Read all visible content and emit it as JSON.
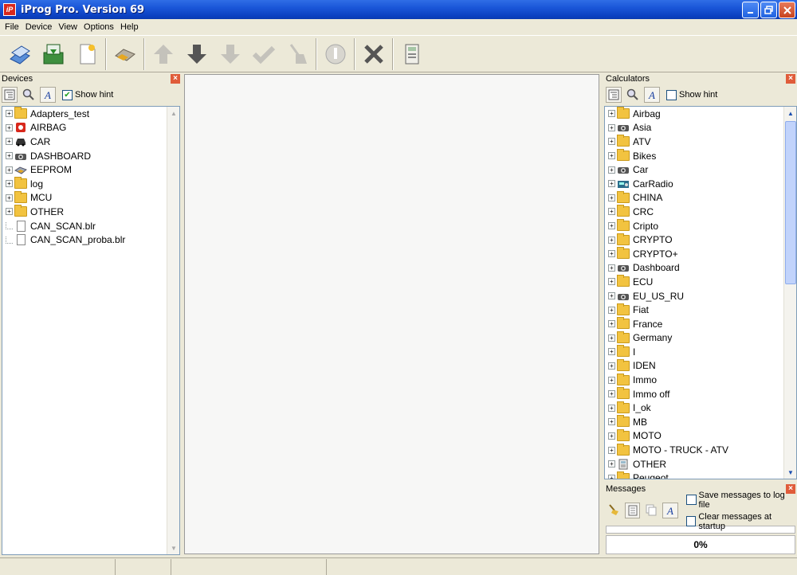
{
  "window": {
    "title": "iProg Pro. Version 69",
    "icon_text": "iP"
  },
  "menu": [
    "File",
    "Device",
    "View",
    "Options",
    "Help"
  ],
  "devices": {
    "title": "Devices",
    "show_hint_label": "Show hint",
    "show_hint_checked": true,
    "items": [
      {
        "label": "Adapters_test",
        "icon": "folder-icon",
        "expandable": true
      },
      {
        "label": "AIRBAG",
        "icon": "airbag-icon",
        "expandable": true
      },
      {
        "label": "CAR",
        "icon": "car-icon",
        "expandable": true
      },
      {
        "label": "DASHBOARD",
        "icon": "dashboard-icon",
        "expandable": true
      },
      {
        "label": "EEPROM",
        "icon": "eeprom-icon",
        "expandable": true
      },
      {
        "label": "log",
        "icon": "folder-icon",
        "expandable": true
      },
      {
        "label": "MCU",
        "icon": "folder-icon",
        "expandable": true
      },
      {
        "label": "OTHER",
        "icon": "folder-icon",
        "expandable": true
      },
      {
        "label": "CAN_SCAN.blr",
        "icon": "file-icon",
        "expandable": false
      },
      {
        "label": "CAN_SCAN_proba.blr",
        "icon": "file-icon",
        "expandable": false
      }
    ]
  },
  "calculators": {
    "title": "Calculators",
    "show_hint_label": "Show hint",
    "show_hint_checked": false,
    "items": [
      {
        "label": "Airbag",
        "icon": "folder-icon"
      },
      {
        "label": "Asia",
        "icon": "camera-icon"
      },
      {
        "label": "ATV",
        "icon": "folder-icon"
      },
      {
        "label": "Bikes",
        "icon": "folder-icon"
      },
      {
        "label": "Car",
        "icon": "camera-icon"
      },
      {
        "label": "CarRadio",
        "icon": "radio-icon"
      },
      {
        "label": "CHINA",
        "icon": "folder-icon"
      },
      {
        "label": "CRC",
        "icon": "folder-icon"
      },
      {
        "label": "Cripto",
        "icon": "folder-icon"
      },
      {
        "label": "CRYPTO",
        "icon": "folder-icon"
      },
      {
        "label": "CRYPTO+",
        "icon": "folder-icon"
      },
      {
        "label": "Dashboard",
        "icon": "camera-icon"
      },
      {
        "label": "ECU",
        "icon": "folder-icon"
      },
      {
        "label": "EU_US_RU",
        "icon": "camera-icon"
      },
      {
        "label": "Fiat",
        "icon": "folder-icon"
      },
      {
        "label": "France",
        "icon": "folder-icon"
      },
      {
        "label": "Germany",
        "icon": "folder-icon"
      },
      {
        "label": "I",
        "icon": "folder-icon"
      },
      {
        "label": "IDEN",
        "icon": "folder-icon"
      },
      {
        "label": "Immo",
        "icon": "folder-icon"
      },
      {
        "label": "Immo off",
        "icon": "folder-icon"
      },
      {
        "label": "I_ok",
        "icon": "folder-icon"
      },
      {
        "label": "MB",
        "icon": "folder-icon"
      },
      {
        "label": "MOTO",
        "icon": "folder-icon"
      },
      {
        "label": "MOTO - TRUCK - ATV",
        "icon": "folder-icon"
      },
      {
        "label": "OTHER",
        "icon": "calculator-icon"
      },
      {
        "label": "Peugeot",
        "icon": "folder-icon"
      }
    ]
  },
  "messages": {
    "title": "Messages",
    "save_log_label": "Save messages to log file",
    "clear_startup_label": "Clear messages at startup",
    "progress_text": "0%",
    "progress_value": 0
  }
}
